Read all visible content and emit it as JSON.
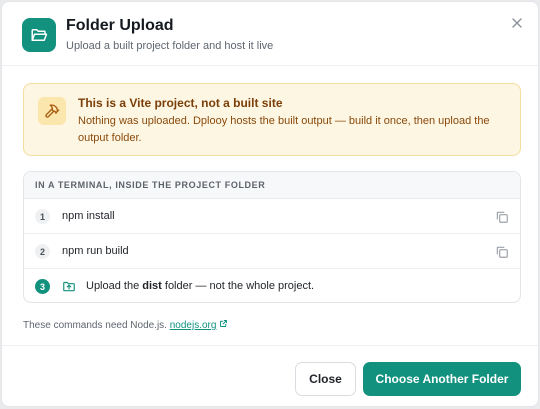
{
  "dialog": {
    "title": "Folder Upload",
    "subtitle": "Upload a built project folder and host it live"
  },
  "alert": {
    "title": "This is a Vite project, not a built site",
    "body": "Nothing was uploaded. Dplooy hosts the built output — build it once, then upload the output folder."
  },
  "steps": {
    "heading": "IN A TERMINAL, INSIDE THE PROJECT FOLDER",
    "items": [
      {
        "num": "1",
        "command": "npm install"
      },
      {
        "num": "2",
        "command": "npm run build"
      },
      {
        "num": "3",
        "prefix": "Upload the ",
        "bold": "dist",
        "suffix": " folder — not the whole project."
      }
    ]
  },
  "note": {
    "text": "These commands need Node.js.",
    "link": "nodejs.org"
  },
  "buttons": {
    "close": "Close",
    "choose": "Choose Another Folder"
  },
  "colors": {
    "accent": "#13917f",
    "warning_bg": "#fdf6e3",
    "warning_text": "#8a4a0b"
  },
  "icons": [
    "folder-open-icon",
    "close-icon",
    "hammer-icon",
    "copy-icon",
    "folder-upload-icon",
    "external-link-icon"
  ]
}
